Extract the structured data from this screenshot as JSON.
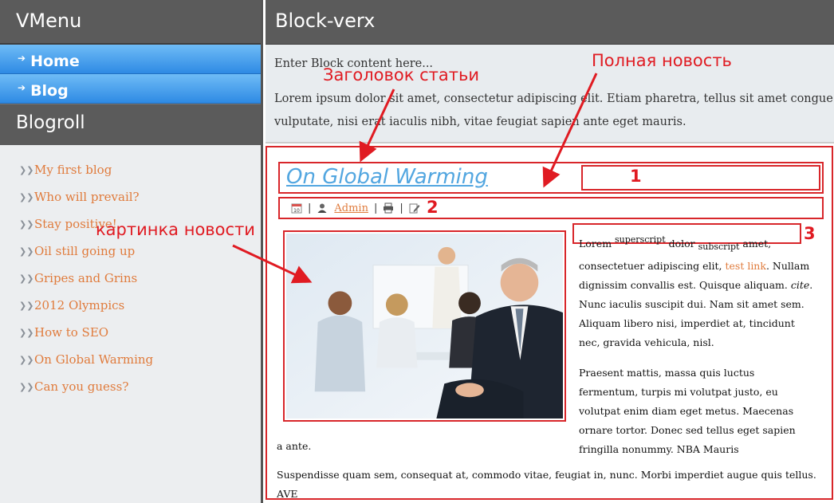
{
  "sidebar": {
    "title": "VMenu",
    "menu": [
      {
        "label": "Home"
      },
      {
        "label": "Blog"
      }
    ],
    "blogroll_title": "Blogroll",
    "blogroll": [
      {
        "label": "My first blog"
      },
      {
        "label": "Who will prevail?"
      },
      {
        "label": "Stay positive!"
      },
      {
        "label": "Oil still going up"
      },
      {
        "label": "Gripes and Grins"
      },
      {
        "label": "2012 Olympics"
      },
      {
        "label": "How to SEO"
      },
      {
        "label": "On Global Warming"
      },
      {
        "label": "Can you guess?"
      }
    ]
  },
  "main": {
    "title": "Block-verx",
    "block_line1": "Enter Block content here...",
    "block_line2": "Lorem ipsum dolor sit amet, consectetur adipiscing elit. Etiam pharetra, tellus sit amet congue vulputate, nisi erat iaculis nibh, vitae feugiat sapien ante eget mauris."
  },
  "article": {
    "title": "On Global Warming",
    "author": "Admin",
    "p1_a": "Lorem ",
    "p1_sup": "superscript",
    "p1_b": " dolor ",
    "p1_sub": "subscript",
    "p1_c": " amet, consectetuer adipiscing elit, ",
    "p1_link": "test link",
    "p1_d": ". Nullam dignissim convallis est. Quisque aliquam. ",
    "p1_cite": "cite",
    "p1_e": ". Nunc iaculis suscipit dui. Nam sit amet sem. Aliquam libero nisi, imperdiet at, tincidunt nec, gravida vehicula, nisl.",
    "p2": "Praesent mattis, massa quis luctus fermentum, turpis mi volutpat justo, eu volutpat enim diam eget metus. Maecenas ornare tortor. Donec sed tellus eget sapien fringilla nonummy. NBA Mauris",
    "p2_cont": "a ante.",
    "p3": "Suspendisse quam sem, consequat at, commodo vitae, feugiat in, nunc. Morbi imperdiet augue quis tellus. AVE"
  },
  "annotations": {
    "article_title": "Заголовок статьи",
    "full_news": "Полная новость",
    "news_image": "картинка новости",
    "n1": "1",
    "n2": "2",
    "n3": "3"
  },
  "colors": {
    "accent_red": "#e01b22",
    "link_orange": "#e07b3c",
    "title_blue": "#52a6e0",
    "menu_blue": "#2e8ae4",
    "header_gray": "#5b5b5b"
  }
}
